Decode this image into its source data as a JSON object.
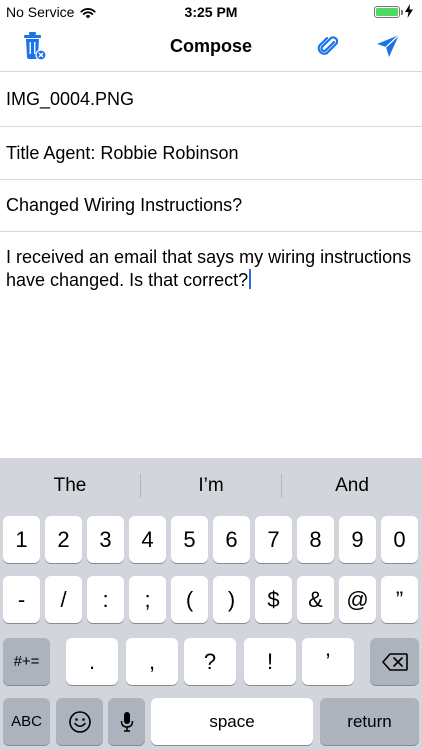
{
  "status_bar": {
    "carrier": "No Service",
    "time": "3:25 PM",
    "battery_level": 1.0
  },
  "nav": {
    "title": "Compose",
    "icons": [
      "trash-icon",
      "paperclip-icon",
      "send-icon"
    ]
  },
  "fields": {
    "attachment": "IMG_0004.PNG",
    "recipient": "Title Agent: Robbie Robinson",
    "subject": "Changed Wiring Instructions?"
  },
  "message_body": "I received an email that says my wiring instructions have changed. Is that correct?",
  "keyboard": {
    "suggestions": [
      "The",
      "I’m",
      "And"
    ],
    "row1": [
      "1",
      "2",
      "3",
      "4",
      "5",
      "6",
      "7",
      "8",
      "9",
      "0"
    ],
    "row2": [
      "-",
      "/",
      ":",
      ";",
      "(",
      ")",
      "$",
      "&",
      "@",
      "”"
    ],
    "row3": {
      "shift_label": "#+=",
      "keys": [
        ".",
        ",",
        "?",
        "!",
        "’"
      ]
    },
    "row4": {
      "abc_label": "ABC",
      "space_label": "space",
      "return_label": "return"
    }
  },
  "colors": {
    "accent": "#1a73e8",
    "keyboard_bg": "#d2d5db",
    "key_dark": "#adb3bc",
    "battery": "#4cd964"
  }
}
